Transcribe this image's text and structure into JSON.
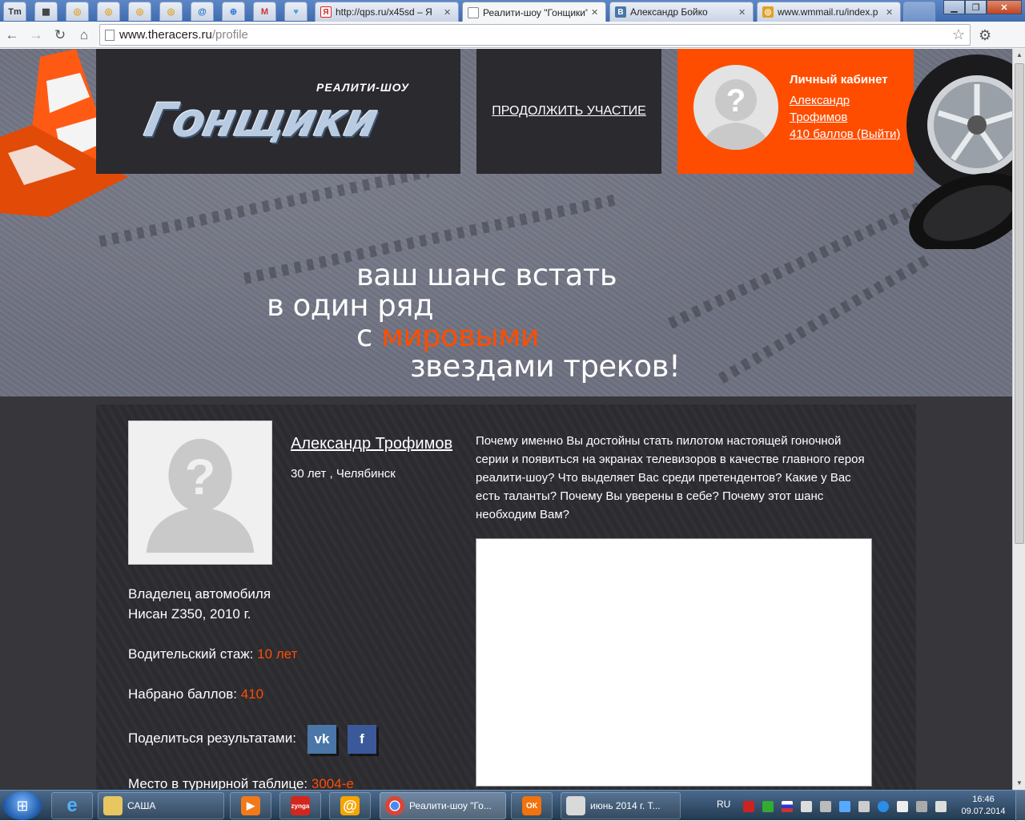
{
  "browser": {
    "tabs": [
      {
        "label": "http://qps.ru/x45sd – Я"
      },
      {
        "label": "Реалити-шоу \"Гонщики\""
      },
      {
        "label": "Александр Бойко"
      },
      {
        "label": "www.wmmail.ru/index.p"
      }
    ],
    "active_tab": 1,
    "pinned_tabs": [
      {
        "icon": "tm-icon",
        "glyph": "Tm"
      },
      {
        "icon": "map-icon",
        "glyph": "▦"
      },
      {
        "icon": "wm-icon",
        "glyph": "◎"
      },
      {
        "icon": "wm-icon",
        "glyph": "◎"
      },
      {
        "icon": "wm-icon",
        "glyph": "◎"
      },
      {
        "icon": "wm-icon",
        "glyph": "◎"
      },
      {
        "icon": "at-icon",
        "glyph": "@"
      },
      {
        "icon": "globe-icon",
        "glyph": "⊕"
      },
      {
        "icon": "gmail-icon",
        "glyph": "M"
      },
      {
        "icon": "heart-icon",
        "glyph": "♥"
      }
    ],
    "url_host": "www.theracers.ru",
    "url_path": "/profile",
    "colors": {
      "accent": "#ff4d00",
      "dark_panel": "#2a2a2f"
    }
  },
  "header": {
    "logo_sub": "РЕАЛИТИ-ШОУ",
    "logo_main": "Гонщики",
    "continue_label": "ПРОДОЛЖИТЬ УЧАСТИЕ",
    "cabinet": {
      "title": "Личный кабинет",
      "name_line1": "Александр",
      "name_line2": "Трофимов",
      "points_logout": "410 баллов (Выйти)"
    }
  },
  "slogan": {
    "line1": "ваш шанс встать",
    "line2": "в один ряд",
    "line3_prefix": "с ",
    "line3_accent": "мировыми",
    "line4": "звездами треков!"
  },
  "profile": {
    "name": "Александр Трофимов",
    "meta": "30 лет , Челябинск",
    "car_label": "Владелец автомобиля",
    "car_value": "Нисан Z350, 2010 г.",
    "experience_label": "Водительский стаж: ",
    "experience_value": "10 лет",
    "points_label": "Набрано баллов: ",
    "points_value": "410",
    "share_label": "Поделиться результатами:",
    "share_vk": "vk",
    "share_fb": "f",
    "rank_label": "Место в турнирной таблице: ",
    "rank_value": "3004-е"
  },
  "question": {
    "text": "Почему именно Вы достойны стать пилотом настоящей гоночной серии и появиться на экранах телевизоров в качестве главного героя реалити-шоу? Что выделяет Вас среди претендентов? Какие у Вас есть таланты? Почему Вы уверены в себе? Почему этот шанс необходим Вам?",
    "answer_value": ""
  },
  "taskbar": {
    "items": [
      {
        "label": "САША",
        "icon": "folder-icon"
      },
      {
        "label": "",
        "icon": "media-player-icon"
      },
      {
        "label": "",
        "icon": "zynga-icon",
        "glyph": "zynga"
      },
      {
        "label": "",
        "icon": "mail-agent-icon",
        "glyph": "@"
      },
      {
        "label": "Реалити-шоу \"Го...",
        "icon": "chrome-icon"
      },
      {
        "label": "",
        "icon": "odnoklassniki-icon",
        "glyph": "ОК"
      },
      {
        "label": "июнь 2014 г.   Т...",
        "icon": "calendar-app-icon"
      }
    ],
    "lang": "RU",
    "time": "16:46",
    "date": "09.07.2014"
  }
}
